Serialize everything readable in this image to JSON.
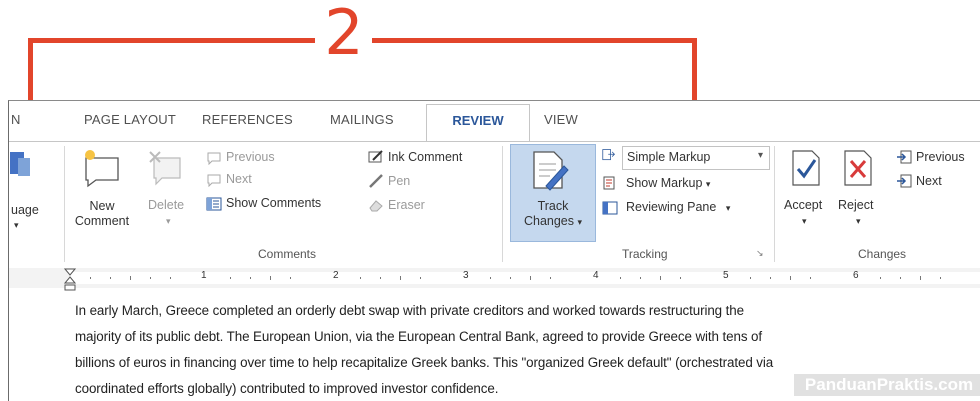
{
  "callout": {
    "number": "2"
  },
  "tabs": [
    {
      "label": "N"
    },
    {
      "label": "PAGE LAYOUT"
    },
    {
      "label": "REFERENCES"
    },
    {
      "label": "MAILINGS"
    },
    {
      "label": "REVIEW",
      "active": true
    },
    {
      "label": "VIEW"
    }
  ],
  "ribbon": {
    "language_partial": "uage",
    "comments": {
      "new_comment": [
        "New",
        "Comment"
      ],
      "delete": "Delete",
      "previous": "Previous",
      "next": "Next",
      "show_comments": "Show Comments",
      "ink_comment": "Ink Comment",
      "pen": "Pen",
      "eraser": "Eraser",
      "group_label": "Comments"
    },
    "tracking": {
      "track_changes": [
        "Track",
        "Changes"
      ],
      "markup_select": "Simple Markup",
      "show_markup": "Show Markup",
      "reviewing_pane": "Reviewing Pane",
      "group_label": "Tracking"
    },
    "changes": {
      "accept": "Accept",
      "reject": "Reject",
      "previous": "Previous",
      "next": "Next",
      "group_label": "Changes"
    }
  },
  "ruler": {
    "marks": [
      "1",
      "2",
      "3",
      "4",
      "5",
      "6"
    ]
  },
  "document": {
    "lines": [
      "In early March, Greece completed an orderly debt swap with private creditors and worked towards restructuring the",
      "majority of its public debt. The European Union, via the European Central Bank, agreed to provide Greece with tens of",
      "billions of euros in financing over time to help recapitalize Greek banks. This \"organized Greek default\" (orchestrated via",
      "coordinated efforts globally) contributed to improved investor confidence."
    ]
  },
  "watermark": "PanduanPraktis.com",
  "colors": {
    "callout": "#e2452b",
    "accent": "#2b579a",
    "track_highlight": "#c5d8ee"
  }
}
